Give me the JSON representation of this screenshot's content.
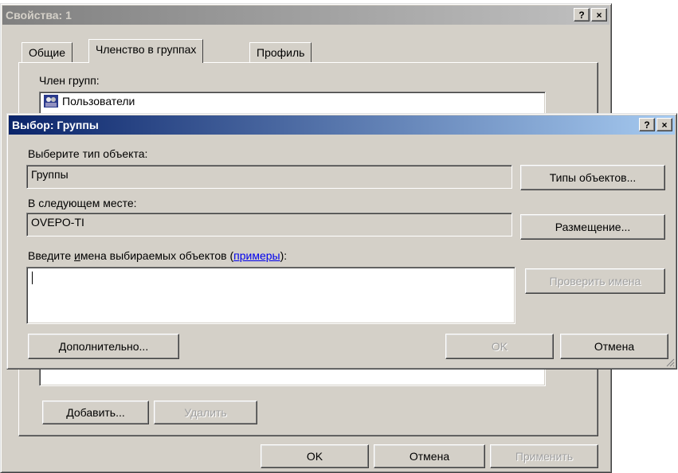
{
  "props_dialog": {
    "title": "Свойства: 1",
    "help_label": "?",
    "close_label": "×",
    "tabs": [
      "Общие",
      "Членство в группах",
      "Профиль"
    ],
    "member_of_label": "Член групп:",
    "members": [
      "Пользователи"
    ],
    "add_label": "Добавить...",
    "remove_label": "Удалить",
    "ok_label": "OK",
    "cancel_label": "Отмена",
    "apply_label": "Применить"
  },
  "select_dialog": {
    "title": "Выбор: Группы",
    "help_label": "?",
    "close_label": "×",
    "object_type_label": "Выберите тип объекта:",
    "object_type_value": "Группы",
    "object_types_button": "Типы объектов...",
    "location_label": "В следующем месте:",
    "location_value": "OVEPO-TI",
    "locations_button": "Размещение...",
    "names_label_pre": "Введите ",
    "names_label_u": "и",
    "names_label_mid": "мена выбираемых объектов (",
    "names_link": "примеры",
    "names_label_post": "):",
    "names_value": "",
    "check_names_button": "Проверить имена",
    "advanced_button": "Дополнительно...",
    "ok_label": "OK",
    "cancel_label": "Отмена"
  }
}
